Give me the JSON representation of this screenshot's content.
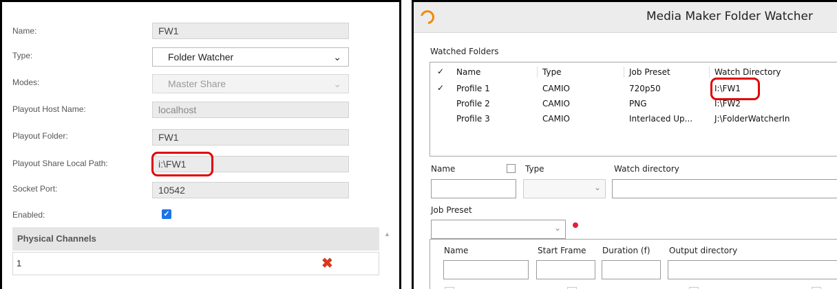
{
  "left_form": {
    "name": {
      "label": "Name:",
      "value": "FW1"
    },
    "type": {
      "label": "Type:",
      "value": "Folder Watcher"
    },
    "modes": {
      "label": "Modes:",
      "value": "Master Share"
    },
    "playout_host": {
      "label": "Playout Host Name:",
      "value": "localhost"
    },
    "playout_folder": {
      "label": "Playout Folder:",
      "value": "FW1"
    },
    "share_local_path": {
      "label": "Playout Share Local Path:",
      "value": "i:\\FW1"
    },
    "socket_port": {
      "label": "Socket Port:",
      "value": "10542"
    },
    "enabled": {
      "label": "Enabled:",
      "checked": true
    },
    "physical_channels": {
      "header": "Physical Channels",
      "rows": [
        "1"
      ]
    }
  },
  "watcher_window": {
    "title": "Media Maker Folder Watcher",
    "watched_folders_label": "Watched Folders",
    "columns": [
      "Name",
      "Type",
      "Job Preset",
      "Watch Directory"
    ],
    "check_mark": "✓",
    "rows": [
      {
        "checked": true,
        "name": "Profile 1",
        "type": "CAMIO",
        "preset": "720p50",
        "dir": "I:\\FW1"
      },
      {
        "checked": false,
        "name": "Profile 2",
        "type": "CAMIO",
        "preset": "PNG",
        "dir": "I:\\FW2"
      },
      {
        "checked": false,
        "name": "Profile 3",
        "type": "CAMIO",
        "preset": "Interlaced Up...",
        "dir": "J:\\FolderWatcherIn"
      }
    ],
    "editor": {
      "name_label": "Name",
      "type_label": "Type",
      "watch_dir_label": "Watch directory",
      "job_preset_label": "Job Preset"
    },
    "outputs": {
      "name_label": "Name",
      "start_frame_label": "Start Frame",
      "duration_label": "Duration (f)",
      "output_dir_label": "Output directory"
    }
  },
  "colors": {
    "highlight": "#e00000",
    "accent_checkbox": "#1a73e8",
    "logo": "#f08a00"
  },
  "icons": {
    "chevron": "chevron-down-icon",
    "delete": "red-x-delete-icon",
    "record": "red-dot-icon"
  }
}
